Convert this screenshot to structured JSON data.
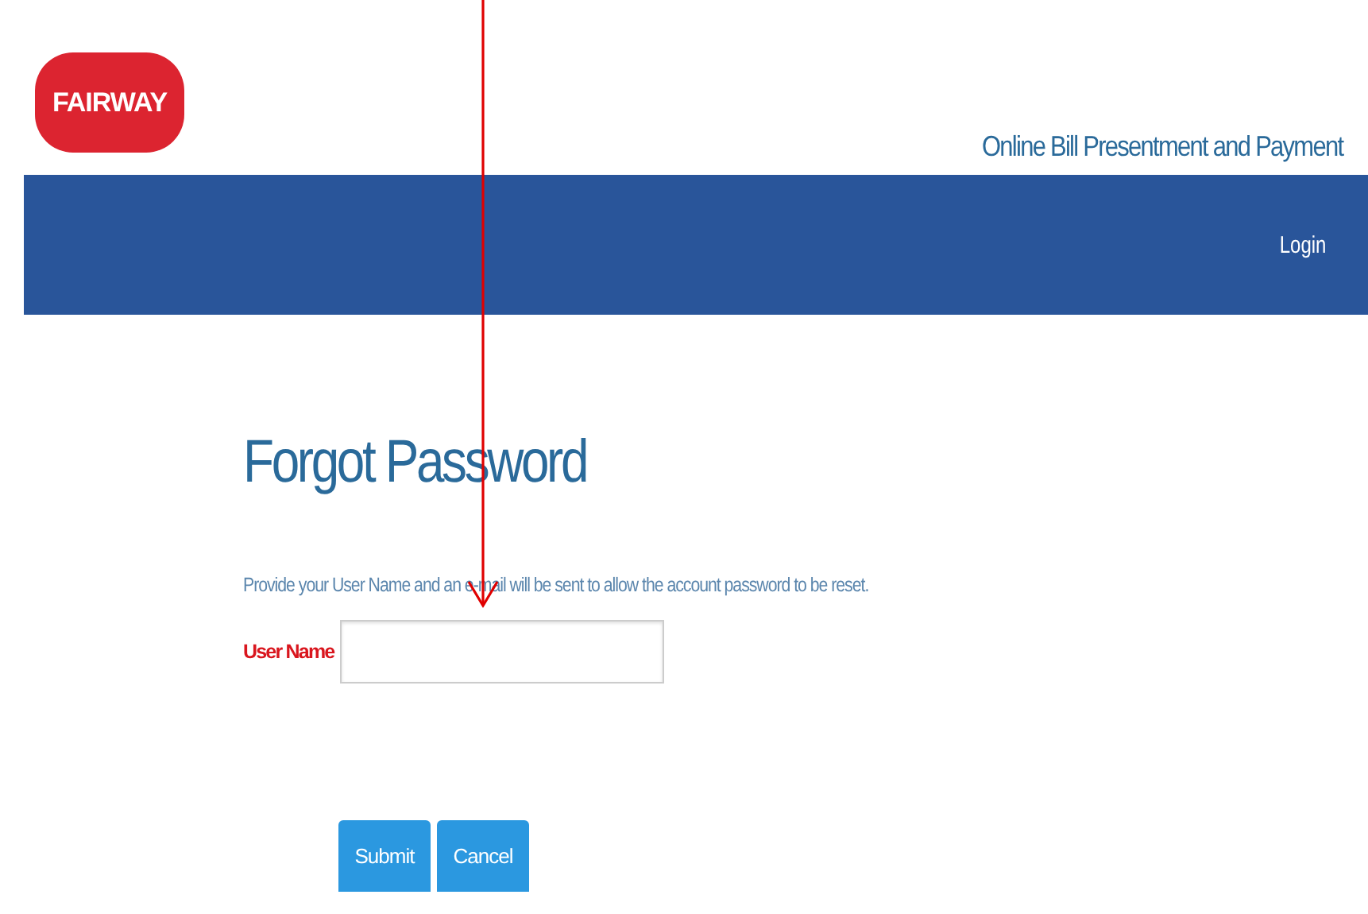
{
  "header": {
    "logo": "FAIRWAY",
    "tagline": "Online Bill Presentment and Payment"
  },
  "nav": {
    "items": [
      {
        "label": "Login"
      }
    ]
  },
  "form": {
    "title": "Forgot Password",
    "instructions": "Provide your User Name and an e-mail will be sent to allow the account password to be reset.",
    "fields": [
      {
        "label": "User Name"
      }
    ],
    "buttons": [
      {
        "label": "Submit"
      },
      {
        "label": "Cancel"
      }
    ]
  }
}
